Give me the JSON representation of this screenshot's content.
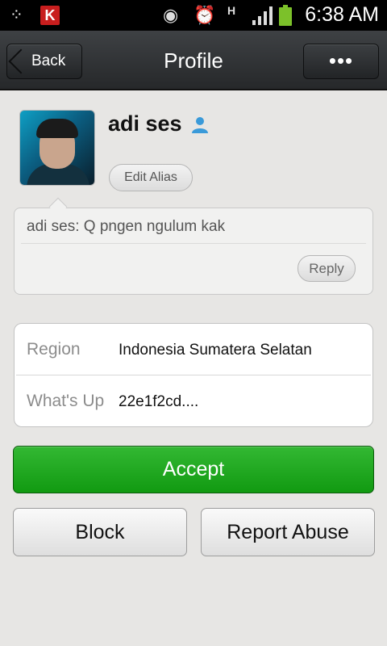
{
  "status_bar": {
    "time": "6:38 AM",
    "network_type": "H",
    "kaspersky_letter": "K",
    "icons": [
      "bbm-icon",
      "kaspersky-icon",
      "eye-icon",
      "alarm-icon",
      "hspa-icon",
      "signal-icon",
      "battery-icon"
    ],
    "battery_color": "#7cc12a"
  },
  "header": {
    "back_label": "Back",
    "title": "Profile",
    "more_label": "•••"
  },
  "profile": {
    "name": "adi ses",
    "edit_alias_label": "Edit Alias",
    "gender_icon": "male-user-icon",
    "gender_icon_color": "#3a9ad9"
  },
  "message": {
    "text": "adi ses: Q pngen ngulum kak",
    "reply_label": "Reply"
  },
  "info": {
    "rows": [
      {
        "label": "Region",
        "value": "Indonesia  Sumatera Selatan"
      },
      {
        "label": "What's Up",
        "value": "22e1f2cd...."
      }
    ]
  },
  "actions": {
    "accept_label": "Accept",
    "block_label": "Block",
    "report_label": "Report Abuse",
    "accept_color": "#1fa51f"
  }
}
